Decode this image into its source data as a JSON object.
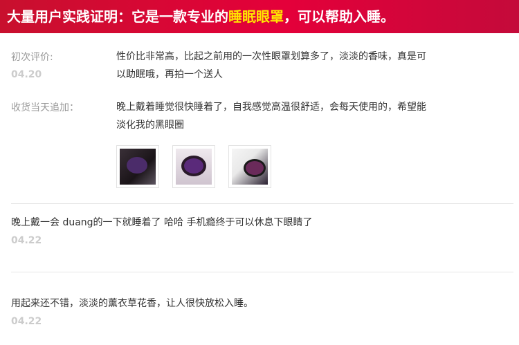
{
  "banner": {
    "prefix": "大量用户实践证明：它是一款专业的",
    "highlight": "睡眠眼罩",
    "suffix": "，可以帮助入睡。"
  },
  "review1": {
    "initial_label": "初次评价:",
    "initial_date": "04.20",
    "initial_text_line1": "性价比非常高，比起之前用的一次性眼罩划算多了，淡淡的香味，真是可",
    "initial_text_line2": "以助眠哦，再拍一个送人",
    "followup_label": "收货当天追加：",
    "followup_text_line1": "晚上戴着睡觉很快睡着了，自我感觉高温很舒适，会每天使用的，希望能",
    "followup_text_line2": "淡化我的黑眼圈"
  },
  "review2": {
    "text": "晚上戴一会 duang的一下就睡着了 哈哈 手机瘾终于可以休息下眼睛了",
    "date": "04.22"
  },
  "review3": {
    "text": "用起来还不错，淡淡的薰衣草花香，让人很快放松入睡。",
    "date": "04.22"
  }
}
